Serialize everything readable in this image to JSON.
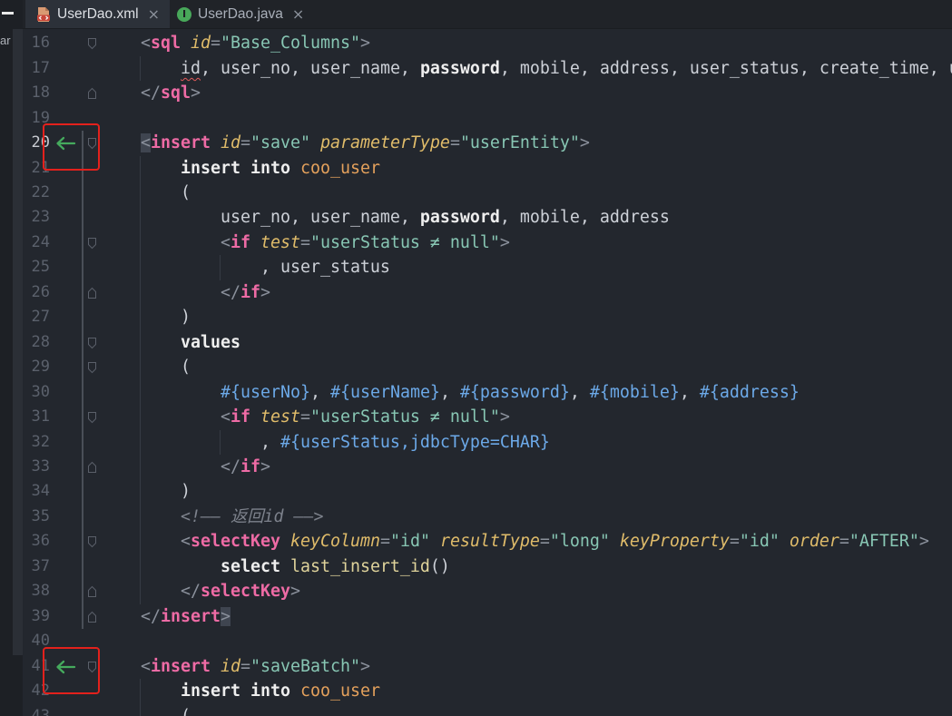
{
  "window": {
    "side_panel": {
      "label_fragment": "ar"
    },
    "tabs": [
      {
        "label": "UserDao.xml",
        "close": "×",
        "active": true
      },
      {
        "label": "UserDao.java",
        "close": "×",
        "icon_letter": "I",
        "active": false
      }
    ]
  },
  "icons": {
    "side_panel_toggle": "minimize-icon",
    "tab_xml": "xml-file-icon",
    "tab_java": "java-interface-icon",
    "tab_close": "close-icon",
    "gutter_navigation": "arrow-left-icon",
    "fold_start": "fold-start-icon",
    "fold_end": "fold-end-icon"
  },
  "colors": {
    "editor_bg": "#23272e",
    "tabbar_bg": "#202328",
    "tab_active_bg": "#2c3139",
    "tab_text": "#a9afb9",
    "tab_text_active": "#dde0e5",
    "side_strip_bg": "#1d2025",
    "side_track_bg": "#2b2f36",
    "punct": "#8a909b",
    "tag": "#ee6ba5",
    "attr": "#e0bc6a",
    "string": "#88c7b4",
    "keyword": "#eeeeee",
    "text": "#cdd1d8",
    "table": "#e4a15c",
    "function": "#dfd39b",
    "param": "#6ca9e8",
    "comment": "#7d828c",
    "line_number": "#5b616c",
    "line_number_current": "#c8cbd1",
    "indent_guide": "#363b44",
    "fold_marker": "#5a5f69",
    "fold_range": "#4a4f58",
    "nav_arrow": "#45aa5d",
    "highlight_box": "#e3211c",
    "brace_match_bg": "#3f4550",
    "error_squiggle": "#e35a5a",
    "xml_icon": "#d99a72",
    "java_icon": "#48a85a"
  },
  "editor": {
    "current_line": 20,
    "active_block_lines": [
      20,
      39
    ],
    "navigation_markers": [
      20,
      41
    ],
    "highlight_boxes": [
      20,
      41
    ],
    "fold_markers": [
      {
        "line": 16,
        "icon": "fold-start-icon"
      },
      {
        "line": 18,
        "icon": "fold-end-icon"
      },
      {
        "line": 20,
        "icon": "fold-start-icon"
      },
      {
        "line": 24,
        "icon": "fold-start-icon"
      },
      {
        "line": 26,
        "icon": "fold-end-icon"
      },
      {
        "line": 28,
        "icon": "fold-start-icon"
      },
      {
        "line": 29,
        "icon": "fold-start-icon"
      },
      {
        "line": 31,
        "icon": "fold-start-icon"
      },
      {
        "line": 33,
        "icon": "fold-end-icon"
      },
      {
        "line": 36,
        "icon": "fold-start-icon"
      },
      {
        "line": 38,
        "icon": "fold-end-icon"
      },
      {
        "line": 39,
        "icon": "fold-end-icon"
      },
      {
        "line": 41,
        "icon": "fold-start-icon"
      }
    ],
    "lines": [
      {
        "n": 16,
        "indent": 0,
        "tokens": [
          {
            "t": "<",
            "s": "punct"
          },
          {
            "t": "sql",
            "s": "tag"
          },
          {
            "t": " id",
            "s": "attr"
          },
          {
            "t": "=",
            "s": "punct"
          },
          {
            "t": "\"Base_Columns\"",
            "s": "string"
          },
          {
            "t": ">",
            "s": "punct"
          }
        ]
      },
      {
        "n": 17,
        "indent": 4,
        "tokens": [
          {
            "t": "id",
            "s": "text",
            "squiggle": true
          },
          {
            "t": ", user_no, user_name, ",
            "s": "text"
          },
          {
            "t": "password",
            "s": "keyword"
          },
          {
            "t": ", mobile, address, user_status, create_time, u",
            "s": "text"
          }
        ]
      },
      {
        "n": 18,
        "indent": 0,
        "tokens": [
          {
            "t": "</",
            "s": "punct"
          },
          {
            "t": "sql",
            "s": "tag"
          },
          {
            "t": ">",
            "s": "punct"
          }
        ]
      },
      {
        "n": 19,
        "indent": 0,
        "tokens": []
      },
      {
        "n": 20,
        "indent": 0,
        "tokens": [
          {
            "t": "<",
            "s": "punct",
            "brace_match": true
          },
          {
            "t": "insert",
            "s": "tag"
          },
          {
            "t": " id",
            "s": "attr"
          },
          {
            "t": "=",
            "s": "punct"
          },
          {
            "t": "\"save\"",
            "s": "string"
          },
          {
            "t": " parameterType",
            "s": "attr"
          },
          {
            "t": "=",
            "s": "punct"
          },
          {
            "t": "\"userEntity\"",
            "s": "string"
          },
          {
            "t": ">",
            "s": "punct"
          }
        ]
      },
      {
        "n": 21,
        "indent": 4,
        "tokens": [
          {
            "t": "insert into",
            "s": "keyword"
          },
          {
            "t": " coo_user",
            "s": "table"
          }
        ]
      },
      {
        "n": 22,
        "indent": 4,
        "tokens": [
          {
            "t": "(",
            "s": "text"
          }
        ]
      },
      {
        "n": 23,
        "indent": 8,
        "tokens": [
          {
            "t": "user_no, user_name, ",
            "s": "text"
          },
          {
            "t": "password",
            "s": "keyword"
          },
          {
            "t": ", mobile, address",
            "s": "text"
          }
        ]
      },
      {
        "n": 24,
        "indent": 8,
        "tokens": [
          {
            "t": "<",
            "s": "punct"
          },
          {
            "t": "if",
            "s": "tag"
          },
          {
            "t": " test",
            "s": "attr"
          },
          {
            "t": "=",
            "s": "punct"
          },
          {
            "t": "\"userStatus ≠ null\"",
            "s": "string"
          },
          {
            "t": ">",
            "s": "punct"
          }
        ]
      },
      {
        "n": 25,
        "indent": 12,
        "tokens": [
          {
            "t": ", user_status",
            "s": "text"
          }
        ]
      },
      {
        "n": 26,
        "indent": 8,
        "tokens": [
          {
            "t": "</",
            "s": "punct"
          },
          {
            "t": "if",
            "s": "tag"
          },
          {
            "t": ">",
            "s": "punct"
          }
        ]
      },
      {
        "n": 27,
        "indent": 4,
        "tokens": [
          {
            "t": ")",
            "s": "text"
          }
        ]
      },
      {
        "n": 28,
        "indent": 4,
        "tokens": [
          {
            "t": "values",
            "s": "keyword"
          }
        ]
      },
      {
        "n": 29,
        "indent": 4,
        "tokens": [
          {
            "t": "(",
            "s": "text"
          }
        ]
      },
      {
        "n": 30,
        "indent": 8,
        "tokens": [
          {
            "t": "#{userNo}",
            "s": "param"
          },
          {
            "t": ", ",
            "s": "text"
          },
          {
            "t": "#{userName}",
            "s": "param"
          },
          {
            "t": ", ",
            "s": "text"
          },
          {
            "t": "#{password}",
            "s": "param"
          },
          {
            "t": ", ",
            "s": "text"
          },
          {
            "t": "#{mobile}",
            "s": "param"
          },
          {
            "t": ", ",
            "s": "text"
          },
          {
            "t": "#{address}",
            "s": "param"
          }
        ]
      },
      {
        "n": 31,
        "indent": 8,
        "tokens": [
          {
            "t": "<",
            "s": "punct"
          },
          {
            "t": "if",
            "s": "tag"
          },
          {
            "t": " test",
            "s": "attr"
          },
          {
            "t": "=",
            "s": "punct"
          },
          {
            "t": "\"userStatus ≠ null\"",
            "s": "string"
          },
          {
            "t": ">",
            "s": "punct"
          }
        ]
      },
      {
        "n": 32,
        "indent": 12,
        "tokens": [
          {
            "t": ", ",
            "s": "text"
          },
          {
            "t": "#{userStatus,jdbcType=CHAR}",
            "s": "param"
          }
        ]
      },
      {
        "n": 33,
        "indent": 8,
        "tokens": [
          {
            "t": "</",
            "s": "punct"
          },
          {
            "t": "if",
            "s": "tag"
          },
          {
            "t": ">",
            "s": "punct"
          }
        ]
      },
      {
        "n": 34,
        "indent": 4,
        "tokens": [
          {
            "t": ")",
            "s": "text"
          }
        ]
      },
      {
        "n": 35,
        "indent": 4,
        "tokens": [
          {
            "t": "<!—— 返回id ——>",
            "s": "comment"
          }
        ]
      },
      {
        "n": 36,
        "indent": 4,
        "tokens": [
          {
            "t": "<",
            "s": "punct"
          },
          {
            "t": "selectKey",
            "s": "tag"
          },
          {
            "t": " keyColumn",
            "s": "attr"
          },
          {
            "t": "=",
            "s": "punct"
          },
          {
            "t": "\"id\"",
            "s": "string"
          },
          {
            "t": " resultType",
            "s": "attr"
          },
          {
            "t": "=",
            "s": "punct"
          },
          {
            "t": "\"long\"",
            "s": "string"
          },
          {
            "t": " keyProperty",
            "s": "attr"
          },
          {
            "t": "=",
            "s": "punct"
          },
          {
            "t": "\"id\"",
            "s": "string"
          },
          {
            "t": " order",
            "s": "attr"
          },
          {
            "t": "=",
            "s": "punct"
          },
          {
            "t": "\"AFTER\"",
            "s": "string"
          },
          {
            "t": ">",
            "s": "punct"
          }
        ]
      },
      {
        "n": 37,
        "indent": 8,
        "tokens": [
          {
            "t": "select",
            "s": "keyword"
          },
          {
            "t": " last_insert_id",
            "s": "function"
          },
          {
            "t": "()",
            "s": "text"
          }
        ]
      },
      {
        "n": 38,
        "indent": 4,
        "tokens": [
          {
            "t": "</",
            "s": "punct"
          },
          {
            "t": "selectKey",
            "s": "tag"
          },
          {
            "t": ">",
            "s": "punct"
          }
        ]
      },
      {
        "n": 39,
        "indent": 0,
        "tokens": [
          {
            "t": "</",
            "s": "punct"
          },
          {
            "t": "insert",
            "s": "tag"
          },
          {
            "t": ">",
            "s": "punct",
            "brace_match": true
          }
        ]
      },
      {
        "n": 40,
        "indent": 0,
        "tokens": []
      },
      {
        "n": 41,
        "indent": 0,
        "tokens": [
          {
            "t": "<",
            "s": "punct"
          },
          {
            "t": "insert",
            "s": "tag"
          },
          {
            "t": " id",
            "s": "attr"
          },
          {
            "t": "=",
            "s": "punct"
          },
          {
            "t": "\"saveBatch\"",
            "s": "string"
          },
          {
            "t": ">",
            "s": "punct"
          }
        ]
      },
      {
        "n": 42,
        "indent": 4,
        "tokens": [
          {
            "t": "insert into",
            "s": "keyword"
          },
          {
            "t": " coo_user",
            "s": "table"
          }
        ]
      },
      {
        "n": 43,
        "indent": 4,
        "tokens": [
          {
            "t": "(",
            "s": "text"
          }
        ]
      }
    ]
  }
}
